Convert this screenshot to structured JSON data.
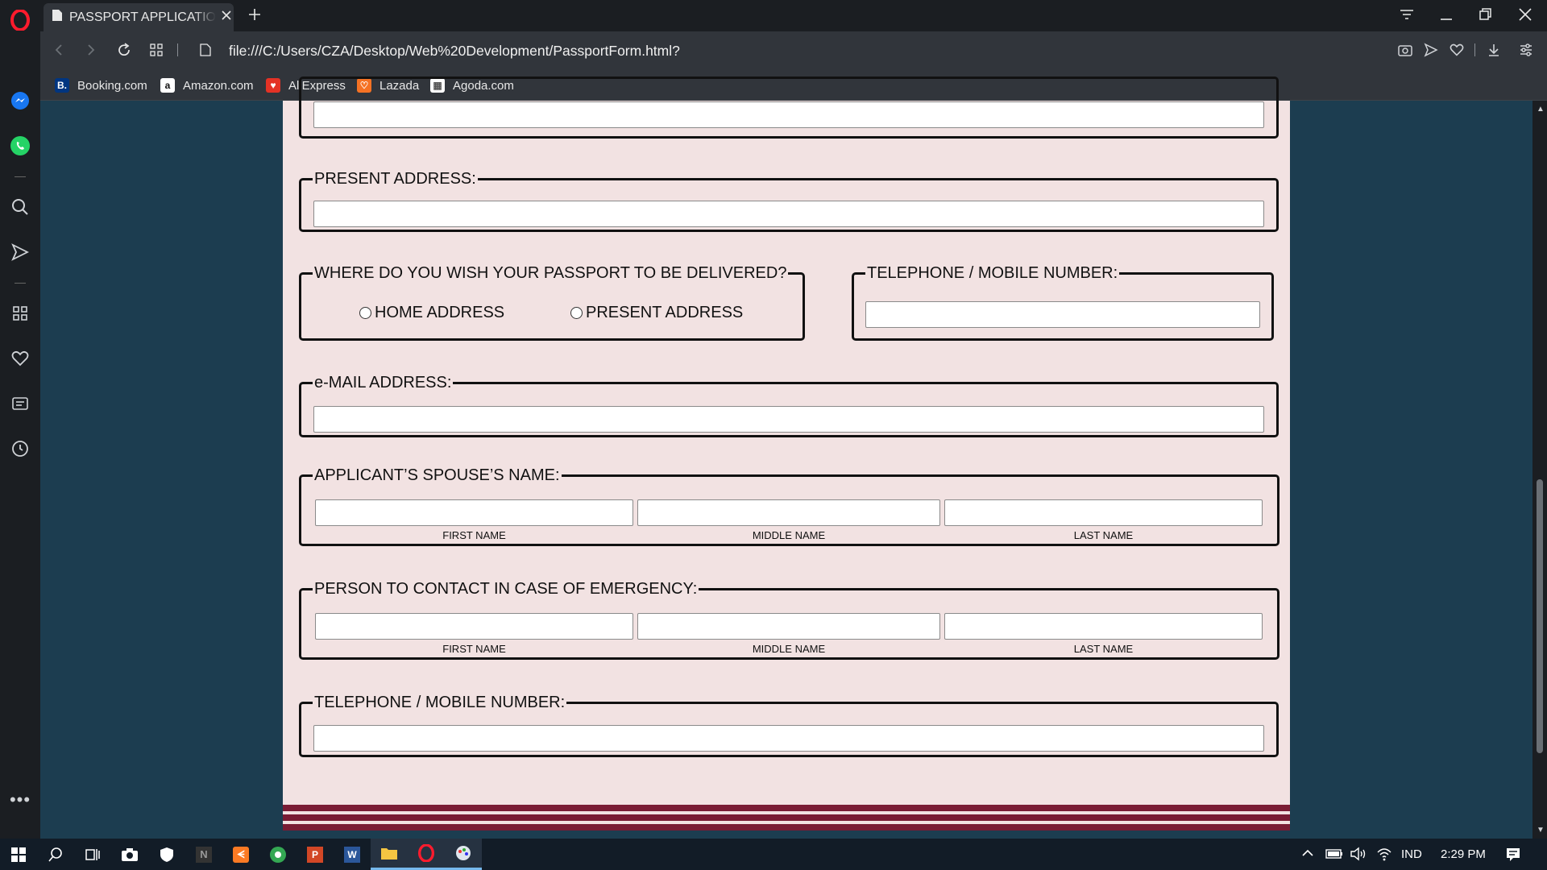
{
  "browser": {
    "tab_title": "PASSPORT APPLICATION FORM",
    "url": "file:///C:/Users/CZA/Desktop/Web%20Development/PassportForm.html?",
    "bookmarks": [
      {
        "label": "Booking.com",
        "icon": "booking-icon",
        "glyph": "B."
      },
      {
        "label": "Amazon.com",
        "icon": "amazon-icon",
        "glyph": "a"
      },
      {
        "label": "AliExpress",
        "icon": "aliexpress-icon",
        "glyph": "♥"
      },
      {
        "label": "Lazada",
        "icon": "lazada-icon",
        "glyph": "♡"
      },
      {
        "label": "Agoda.com",
        "icon": "agoda-icon",
        "glyph": "▦"
      }
    ]
  },
  "form": {
    "present_address": {
      "legend": "PRESENT ADDRESS:"
    },
    "delivery": {
      "legend": "WHERE DO YOU WISH YOUR PASSPORT TO BE DELIVERED?",
      "options": [
        "HOME ADDRESS",
        "PRESENT ADDRESS"
      ]
    },
    "telephone_top": {
      "legend": "TELEPHONE / MOBILE NUMBER:"
    },
    "email": {
      "legend": "e-MAIL ADDRESS:"
    },
    "spouse": {
      "legend": "APPLICANT’S SPOUSE’S NAME:",
      "sublabels": [
        "FIRST NAME",
        "MIDDLE NAME",
        "LAST NAME"
      ]
    },
    "emergency": {
      "legend": "PERSON TO CONTACT IN CASE OF EMERGENCY:",
      "sublabels": [
        "FIRST NAME",
        "MIDDLE NAME",
        "LAST NAME"
      ]
    },
    "telephone_bottom": {
      "legend": "TELEPHONE / MOBILE NUMBER:"
    }
  },
  "taskbar": {
    "language": "IND",
    "time": "2:29 PM"
  },
  "colors": {
    "form_bg": "#f2e2e2",
    "page_bg": "#1c3d50",
    "stripe_maroon": "#7a1c34",
    "opera_red": "#ff1b2d"
  }
}
